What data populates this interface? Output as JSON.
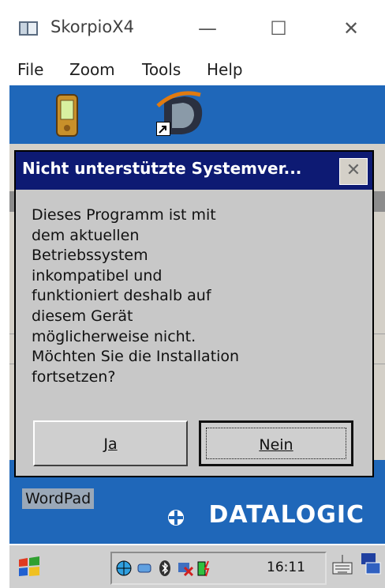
{
  "window": {
    "title": "SkorpioX4",
    "minimize_glyph": "—",
    "maximize_glyph": "☐",
    "close_glyph": "✕"
  },
  "menu": {
    "items": [
      "File",
      "Zoom",
      "Tools",
      "Help"
    ]
  },
  "desktop": {
    "wordpad_label": "WordPad",
    "brand": "DATALOGIC"
  },
  "dialog": {
    "title": "Nicht unterstützte Systemver...",
    "close_glyph": "✕",
    "message": "Dieses Programm ist mit\ndem aktuellen\nBetriebssystem\ninkompatibel und\nfunktioniert deshalb auf\ndiesem Gerät\nmöglicherweise nicht.\nMöchten Sie die Installation\nfortsetzen?",
    "yes_label": "Ja",
    "no_label": "Nein"
  },
  "taskbar": {
    "clock": "16:11"
  },
  "colors": {
    "desktop_bg": "#1f67b9",
    "dialog_title_bg": "#0d1a73",
    "dialog_bg": "#c8c8c8"
  }
}
